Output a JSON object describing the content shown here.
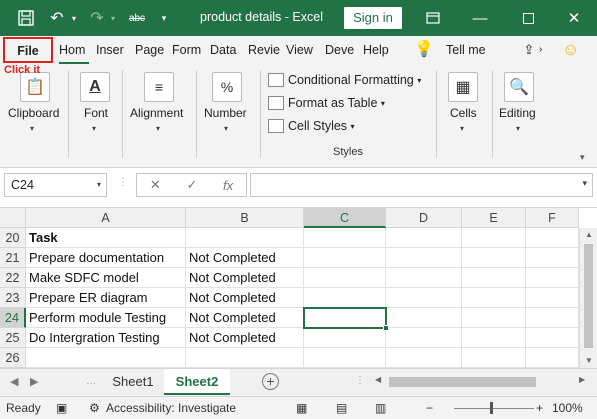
{
  "title_bar": {
    "title": "product details  -  Excel",
    "signin_label": "Sign in",
    "font_format_label": "abc"
  },
  "tabs": [
    {
      "label": "File"
    },
    {
      "label": "Hom"
    },
    {
      "label": "Inser"
    },
    {
      "label": "Page"
    },
    {
      "label": "Form"
    },
    {
      "label": "Data"
    },
    {
      "label": "Revie"
    },
    {
      "label": "View"
    },
    {
      "label": "Deve"
    },
    {
      "label": "Help"
    }
  ],
  "tell_me": "Tell me",
  "annotation": "Click it",
  "ribbon": {
    "clipboard": "Clipboard",
    "font": "Font",
    "alignment": "Alignment",
    "number": "Number",
    "number_glyph": "%",
    "conditional_formatting": "Conditional Formatting",
    "format_as_table": "Format as Table",
    "cell_styles": "Cell Styles",
    "styles": "Styles",
    "cells": "Cells",
    "editing": "Editing"
  },
  "formula_bar": {
    "name_box": "C24",
    "fx": "fx",
    "formula": ""
  },
  "grid": {
    "columns": [
      "A",
      "B",
      "C",
      "D",
      "E",
      "F"
    ],
    "rows": [
      {
        "num": "20",
        "a": "Task",
        "b": ""
      },
      {
        "num": "21",
        "a": "Prepare documentation",
        "b": "Not Completed"
      },
      {
        "num": "22",
        "a": "Make SDFC model",
        "b": "Not Completed"
      },
      {
        "num": "23",
        "a": "Prepare ER diagram",
        "b": "Not Completed"
      },
      {
        "num": "24",
        "a": "Perform module Testing",
        "b": "Not Completed"
      },
      {
        "num": "25",
        "a": "Do Intergration Testing",
        "b": "Not Completed"
      },
      {
        "num": "26",
        "a": "",
        "b": ""
      }
    ]
  },
  "sheets": [
    {
      "label": "Sheet1",
      "active": false
    },
    {
      "label": "Sheet2",
      "active": true
    }
  ],
  "status": {
    "ready": "Ready",
    "accessibility": "Accessibility: Investigate",
    "zoom": "100%"
  },
  "colors": {
    "accent": "#217346",
    "highlight": "#e0211b"
  }
}
